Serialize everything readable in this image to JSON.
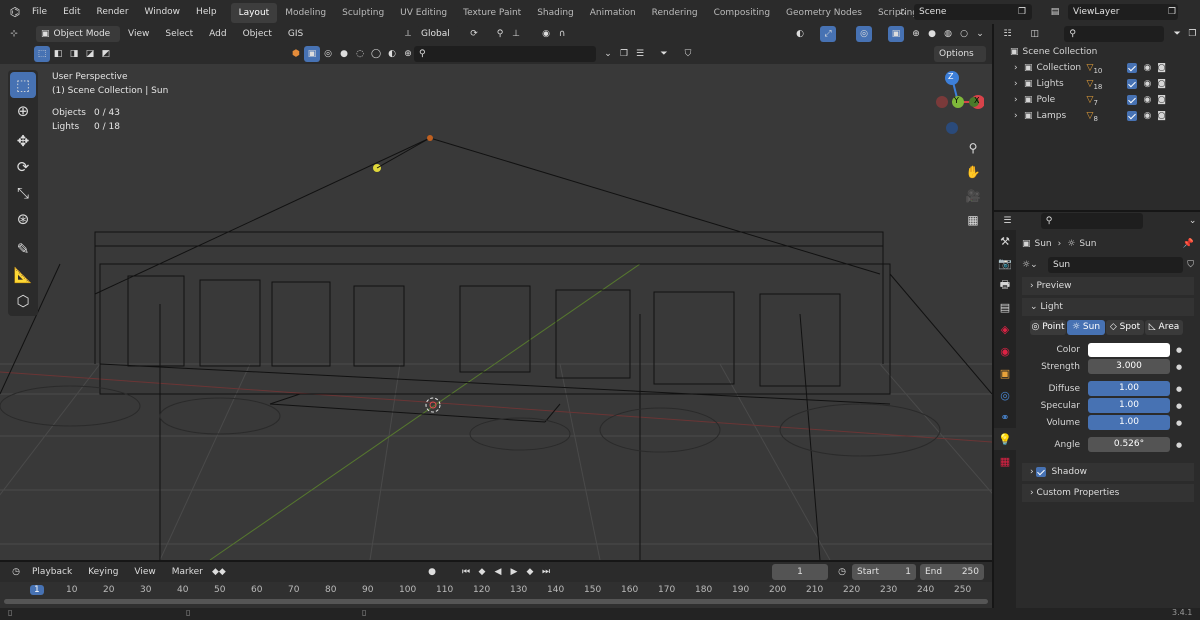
{
  "topbar": {
    "menus": [
      "File",
      "Edit",
      "Render",
      "Window",
      "Help"
    ],
    "workspaces": [
      "Layout",
      "Modeling",
      "Sculpting",
      "UV Editing",
      "Texture Paint",
      "Shading",
      "Animation",
      "Rendering",
      "Compositing",
      "Geometry Nodes",
      "Scripting"
    ],
    "active_workspace": "Layout",
    "add_tab": "+",
    "scene": "Scene",
    "view_layer": "ViewLayer"
  },
  "viewport_header": {
    "mode": "Object Mode",
    "menus": [
      "View",
      "Select",
      "Add",
      "Object",
      "GIS"
    ],
    "orientation": "Global",
    "options_label": "Options"
  },
  "viewport_overlay": {
    "perspective": "User Perspective",
    "context": "(1) Scene Collection | Sun",
    "stats": [
      {
        "label": "Objects",
        "value": "0 / 43"
      },
      {
        "label": "Lights",
        "value": "0 / 18"
      }
    ]
  },
  "gizmo": {
    "z": "Z",
    "y": "Y",
    "x": "X"
  },
  "timeline": {
    "menus": [
      "Playback",
      "Keying",
      "View",
      "Marker"
    ],
    "current_frame": "1",
    "start_label": "Start",
    "start": "1",
    "end_label": "End",
    "end": "250",
    "ticks": [
      "1",
      "10",
      "20",
      "30",
      "40",
      "50",
      "60",
      "70",
      "80",
      "90",
      "100",
      "110",
      "120",
      "130",
      "140",
      "150",
      "160",
      "170",
      "180",
      "190",
      "200",
      "210",
      "220",
      "230",
      "240",
      "250"
    ]
  },
  "status": {
    "version": "3.4.1"
  },
  "outliner": {
    "root": "Scene Collection",
    "items": [
      {
        "label": "Collection",
        "count": "10"
      },
      {
        "label": "Lights",
        "count": "18"
      },
      {
        "label": "Pole",
        "count": "7"
      },
      {
        "label": "Lamps",
        "count": "8"
      }
    ]
  },
  "properties": {
    "breadcrumb": [
      "Sun",
      "Sun"
    ],
    "datablock": "Sun",
    "preview_panel": "Preview",
    "light_panel": "Light",
    "light_types": [
      "Point",
      "Sun",
      "Spot",
      "Area"
    ],
    "active_type": "Sun",
    "fields": {
      "color_label": "Color",
      "color_value": "#ffffff",
      "strength_label": "Strength",
      "strength": "3.000",
      "diffuse_label": "Diffuse",
      "diffuse": "1.00",
      "specular_label": "Specular",
      "specular": "1.00",
      "volume_label": "Volume",
      "volume": "1.00",
      "angle_label": "Angle",
      "angle": "0.526°"
    },
    "shadow_panel": "Shadow",
    "custom_props_panel": "Custom Properties"
  },
  "colors": {
    "accent": "#4772b3",
    "viewport_bg": "#393939",
    "panel_bg": "#2b2b2b"
  }
}
